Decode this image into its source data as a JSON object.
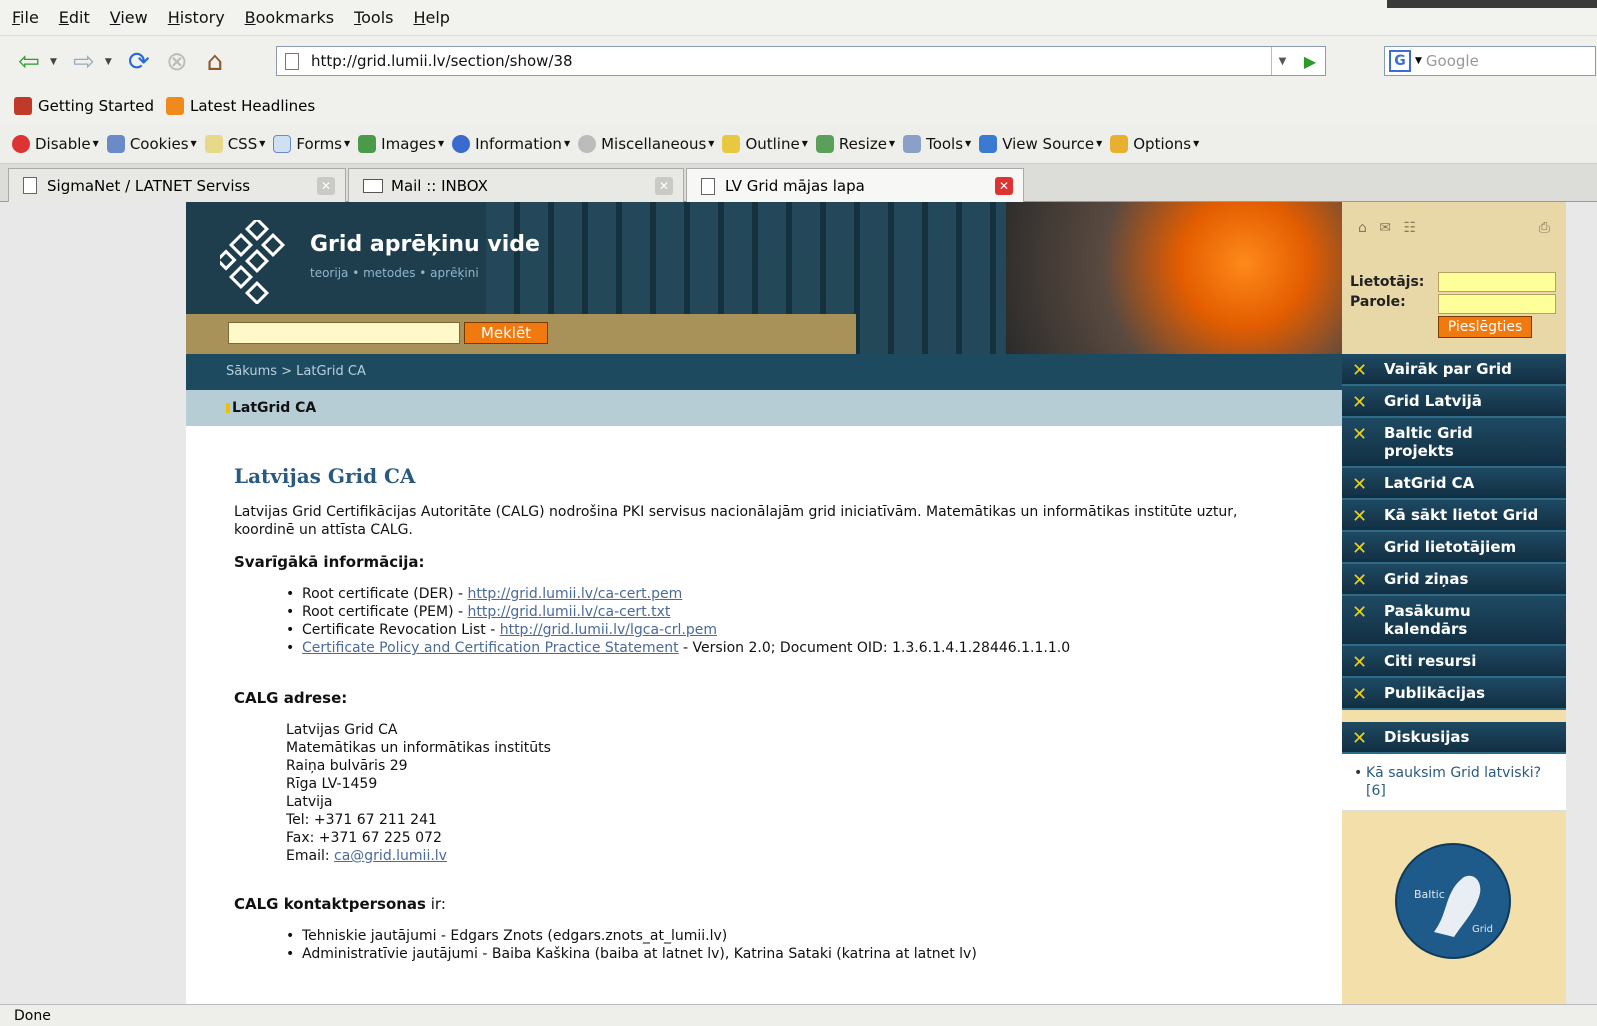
{
  "menu": [
    "File",
    "Edit",
    "View",
    "History",
    "Bookmarks",
    "Tools",
    "Help"
  ],
  "address": {
    "url": "http://grid.lumii.lv/section/show/38",
    "search_placeholder": "Google"
  },
  "bookmarks": [
    {
      "label": "Getting Started",
      "icon": "firefox-getting-started-icon"
    },
    {
      "label": "Latest Headlines",
      "icon": "rss-icon"
    }
  ],
  "devtools": [
    "Disable",
    "Cookies",
    "CSS",
    "Forms",
    "Images",
    "Information",
    "Miscellaneous",
    "Outline",
    "Resize",
    "Tools",
    "View Source",
    "Options"
  ],
  "tabs": [
    {
      "label": "SigmaNet / LATNET Serviss"
    },
    {
      "label": "Mail :: INBOX"
    },
    {
      "label": "LV Grid mājas lapa"
    }
  ],
  "status": "Done",
  "site": {
    "title": "Grid aprēķinu vide",
    "subtitle": "teorija • metodes • aprēķini",
    "search_button": "Meklēt",
    "breadcrumb": "Sākums > LatGrid CA",
    "page_title_bar": "LatGrid CA"
  },
  "login": {
    "user_label": "Lietotājs:",
    "pass_label": "Parole:",
    "button": "Pieslēgties"
  },
  "sidebar": {
    "items": [
      "Vairāk par Grid",
      "Grid Latvijā",
      "Baltic Grid projekts",
      "LatGrid CA",
      "Kā sākt lietot Grid",
      "Grid lietotājiem",
      "Grid ziņas",
      "Pasākumu kalendārs",
      "Citi resursi",
      "Publikācijas"
    ],
    "discussions_title": "Diskusijas",
    "discussion_link": "Kā sauksim Grid latviski? [6]"
  },
  "content": {
    "heading": "Latvijas Grid CA",
    "intro": "Latvijas Grid Certifikācijas Autoritāte (CALG) nodrošina PKI servisus nacionālajām grid iniciatīvām. Matemātikas un informātikas institūte uztur, koordinē un attīsta CALG.",
    "important_heading": "Svarīgākā informācija:",
    "important": [
      {
        "prefix": "Root certificate (DER) - ",
        "link": "http://grid.lumii.lv/ca-cert.pem",
        "suffix": ""
      },
      {
        "prefix": "Root certificate (PEM) - ",
        "link": "http://grid.lumii.lv/ca-cert.txt",
        "suffix": ""
      },
      {
        "prefix": "Certificate Revocation List - ",
        "link": "http://grid.lumii.lv/lgca-crl.pem",
        "suffix": ""
      },
      {
        "prefix": "",
        "link": "Certificate Policy and Certification Practice Statement",
        "suffix": " - Version 2.0; Document OID: 1.3.6.1.4.1.28446.1.1.1.0"
      }
    ],
    "address_heading": "CALG adrese:",
    "address_lines": [
      "Latvijas Grid CA",
      "Matemātikas un informātikas institūts",
      "Raiņa bulvāris 29",
      "Rīga LV-1459",
      "Latvija",
      "Tel: +371 67 211 241",
      "Fax: +371 67 225 072"
    ],
    "email_label": "Email: ",
    "email": "ca@grid.lumii.lv",
    "contacts_heading": "CALG kontaktpersonas",
    "contacts_suffix": " ir:",
    "contacts": [
      "Tehniskie jautājumi - Edgars Znots (edgars.znots_at_lumii.lv)",
      "Administratīvie jautājumi - Baiba Kaškina (baiba at latnet lv), Katrina Sataki (katrina at latnet lv)"
    ]
  }
}
